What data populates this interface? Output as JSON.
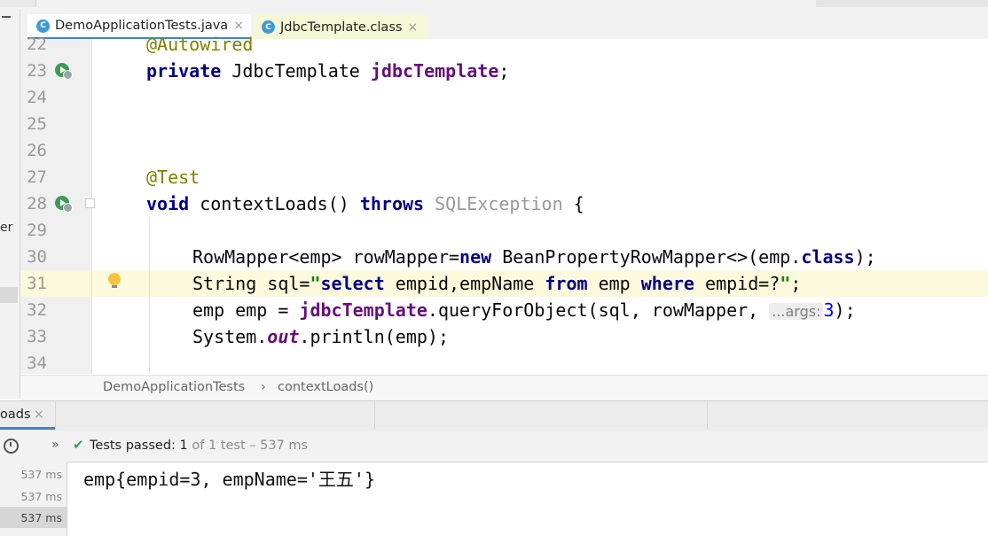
{
  "tabs": [
    {
      "label": "DemoApplicationTests.java",
      "icon": "class-icon",
      "active": true
    },
    {
      "label": "JdbcTemplate.class",
      "icon": "class-icon",
      "active": false
    }
  ],
  "left_panel_text": "er",
  "line_numbers": [
    "22",
    "23",
    "24",
    "25",
    "26",
    "27",
    "28",
    "29",
    "30",
    "31",
    "32",
    "33",
    "34"
  ],
  "code": {
    "l22": "@Autowired",
    "l23_kw": "private",
    "l23_type": " JdbcTemplate ",
    "l23_field": "jdbcTemplate",
    "l23_end": ";",
    "l27": "@Test",
    "l28_kw1": "void",
    "l28_mid": " contextLoads() ",
    "l28_kw2": "throws",
    "l28_sp": " ",
    "l28_exc": "SQLException",
    "l28_end": " {",
    "l30_a": "RowMapper<emp> rowMapper=",
    "l30_new": "new",
    "l30_b": " BeanPropertyRowMapper<>(emp.",
    "l30_class": "class",
    "l30_c": ");",
    "l31_a": "String sql=",
    "l31_q1": "\"",
    "l31_s1": "select",
    "l31_s2": " empid,empName ",
    "l31_s3": "from",
    "l31_s4": " emp ",
    "l31_s5": "where",
    "l31_s6": " empid=?",
    "l31_q2": "\"",
    "l31_end": ";",
    "l32_a": "emp emp = ",
    "l32_field": "jdbcTemplate",
    "l32_b": ".queryForObject(sql, rowMapper, ",
    "l32_hint": "...args:",
    "l32_num": "3",
    "l32_end": ");",
    "l33_a": "System.",
    "l33_out": "out",
    "l33_b": ".println(emp);"
  },
  "breadcrumb": {
    "item1": "DemoApplicationTests",
    "sep": "›",
    "item2": "contextLoads()"
  },
  "run": {
    "tab_label": "oads",
    "tab_close": "×",
    "tests_passed_label": "Tests passed:",
    "tests_passed_count": "1",
    "tests_total": "of 1 test – 537 ms",
    "durations": [
      "537 ms",
      "537 ms",
      "537 ms"
    ],
    "output": "emp{empid=3, empName='王五'}"
  },
  "colors": {
    "accent": "#4083c9",
    "pass_green": "#3c9b57",
    "keyword": "#000080",
    "field": "#660e7a",
    "annotation": "#808000",
    "string": "#008000"
  }
}
